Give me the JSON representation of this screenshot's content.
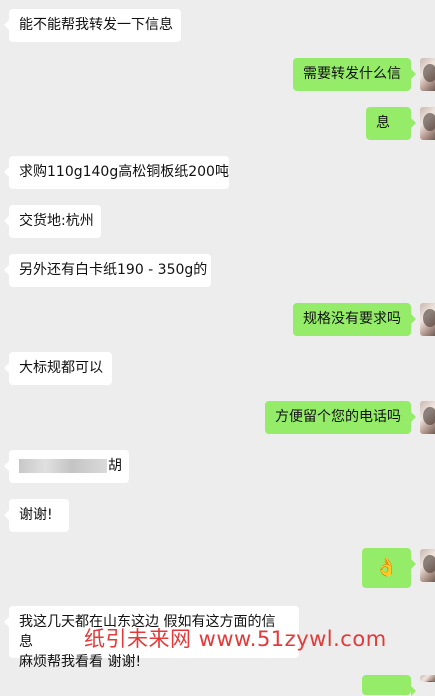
{
  "messages": [
    {
      "side": "left",
      "text": "能不能帮我转发一下信息"
    },
    {
      "side": "right",
      "text": "需要转发什么信"
    },
    {
      "side": "right",
      "text": "息"
    },
    {
      "side": "left",
      "text": "求购110g140g高松铜板纸200吨"
    },
    {
      "side": "left",
      "text": "交货地:杭州"
    },
    {
      "side": "left",
      "text": "另外还有白卡纸190 - 350g的"
    },
    {
      "side": "right",
      "text": "规格没有要求吗"
    },
    {
      "side": "left",
      "text": "大标规都可以"
    },
    {
      "side": "right",
      "text": "方便留个您的电话吗"
    },
    {
      "side": "left",
      "text": "胡",
      "redacted": true
    },
    {
      "side": "left",
      "text": "谢谢!"
    },
    {
      "side": "right",
      "text": "👌",
      "emoji_name": "ok-hand-emoji"
    },
    {
      "side": "left",
      "text_line1": "我这几天都在山东这边 假如有这方面的信息",
      "text_line2": "麻烦帮我看看 谢谢!"
    }
  ],
  "watermark": {
    "text": "纸引未来网  www.51zywl.com",
    "color": "#e23a3a"
  },
  "colors": {
    "background": "#ededed",
    "incoming_bubble": "#ffffff",
    "outgoing_bubble": "#95ec69"
  },
  "icons": {
    "avatar": "avatar-photo"
  }
}
